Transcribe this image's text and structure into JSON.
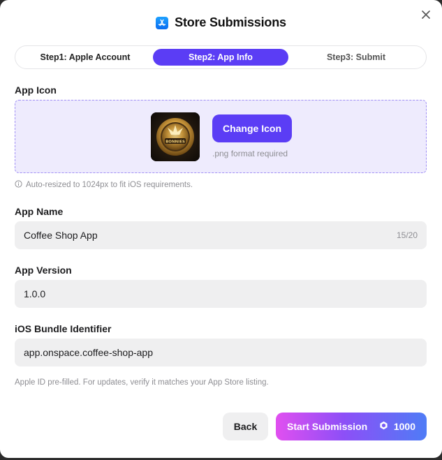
{
  "dialog": {
    "title": "Store Submissions",
    "icon": "app-store-icon",
    "close_icon": "close-icon"
  },
  "steps": [
    {
      "label": "Step1: Apple Account",
      "active": false
    },
    {
      "label": "Step2: App Info",
      "active": true
    },
    {
      "label": "Step3: Submit",
      "active": false
    }
  ],
  "app_icon": {
    "label": "App Icon",
    "change_button": "Change Icon",
    "format_hint": ".png format required",
    "resize_note": "Auto-resized to 1024px to fit iOS requirements.",
    "thumbnail_text": "BONNIES"
  },
  "app_name": {
    "label": "App Name",
    "value": "Coffee Shop App",
    "counter": "15/20"
  },
  "app_version": {
    "label": "App Version",
    "value": "1.0.0"
  },
  "bundle_id": {
    "label": "iOS Bundle Identifier",
    "value": "app.onspace.coffee-shop-app"
  },
  "footer_note": "Apple ID pre-filled. For updates, verify it matches your App Store listing.",
  "actions": {
    "back": "Back",
    "submit": "Start Submission",
    "credits": "1000"
  },
  "colors": {
    "accent": "#5b3df5",
    "icon_zone_bg": "#eeebfd",
    "field_bg": "#efeff0"
  }
}
